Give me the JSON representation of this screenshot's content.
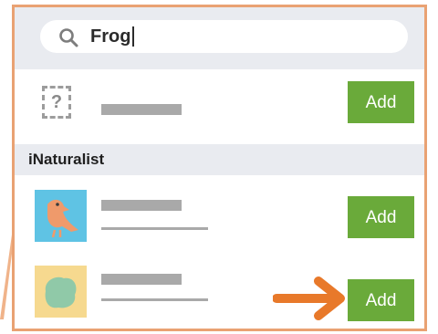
{
  "search": {
    "query": "Frog",
    "icon": "search-icon"
  },
  "placeholder_result": {
    "icon_glyph": "?",
    "icon": "unknown-species-icon",
    "add_label": "Add"
  },
  "section": {
    "label": "iNaturalist"
  },
  "results": [
    {
      "icon": "bird-thumbnail",
      "add_label": "Add"
    },
    {
      "icon": "leaf-thumbnail",
      "add_label": "Add"
    }
  ],
  "colors": {
    "frame_border": "#e9a273",
    "add_button": "#6aaa3a",
    "arrow": "#e8792a",
    "header_bg": "#e9ebf0"
  }
}
